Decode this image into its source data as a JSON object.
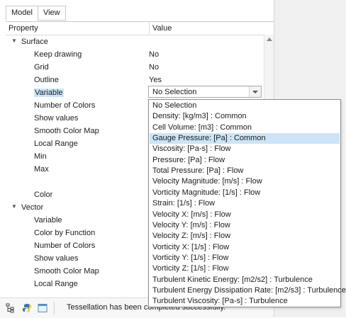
{
  "tabs": [
    {
      "label": "Model"
    },
    {
      "label": "View"
    }
  ],
  "table": {
    "header": {
      "property": "Property",
      "value": "Value"
    },
    "rows": [
      {
        "label": "Surface",
        "value": "",
        "group": true
      },
      {
        "label": "Keep drawing",
        "value": "No"
      },
      {
        "label": "Grid",
        "value": "No"
      },
      {
        "label": "Outline",
        "value": "Yes"
      },
      {
        "label": "Variable",
        "value": "",
        "selected": true
      },
      {
        "label": "Number of Colors",
        "value": ""
      },
      {
        "label": "Show values",
        "value": ""
      },
      {
        "label": "Smooth Color Map",
        "value": ""
      },
      {
        "label": "Local Range",
        "value": ""
      },
      {
        "label": "Min",
        "value": ""
      },
      {
        "label": "Max",
        "value": ""
      },
      {
        "label": "",
        "value": ""
      },
      {
        "label": "Color",
        "value": ""
      },
      {
        "label": "Vector",
        "value": "",
        "group": true
      },
      {
        "label": "Variable",
        "value": ""
      },
      {
        "label": "Color by Function",
        "value": ""
      },
      {
        "label": "Number of Colors",
        "value": ""
      },
      {
        "label": "Show values",
        "value": ""
      },
      {
        "label": "Smooth Color Map",
        "value": ""
      },
      {
        "label": "Local Range",
        "value": ""
      }
    ]
  },
  "variable_select": {
    "value": "No Selection"
  },
  "dropdown": {
    "highlighted_index": 3,
    "options": [
      "No Selection",
      "Density: [kg/m3] : Common",
      "Cell Volume: [m3] : Common",
      "Gauge Pressure: [Pa] : Common",
      "Viscosity: [Pa-s] : Flow",
      "Pressure: [Pa] : Flow",
      "Total Pressure: [Pa] : Flow",
      "Velocity Magnitude: [m/s] : Flow",
      "Vorticity Magnitude: [1/s] : Flow",
      "Strain: [1/s] : Flow",
      "Velocity X: [m/s] : Flow",
      "Velocity Y: [m/s] : Flow",
      "Velocity Z: [m/s] : Flow",
      "Vorticity X: [1/s] : Flow",
      "Vorticity Y: [1/s] : Flow",
      "Vorticity Z: [1/s] : Flow",
      "Turbulent Kinetic Energy: [m2/s2] : Turbulence",
      "Turbulent Energy Dissipation Rate: [m2/s3] : Turbulence",
      "Turbulent Viscosity: [Pa-s] : Turbulence"
    ]
  },
  "status": {
    "message": "Tessellation has been completed successfully.",
    "icons": [
      "tree-view-icon",
      "python-icon",
      "window-icon"
    ]
  },
  "colors": {
    "highlight": "#cce4f7",
    "accent_blue": "#2f6fb8"
  }
}
